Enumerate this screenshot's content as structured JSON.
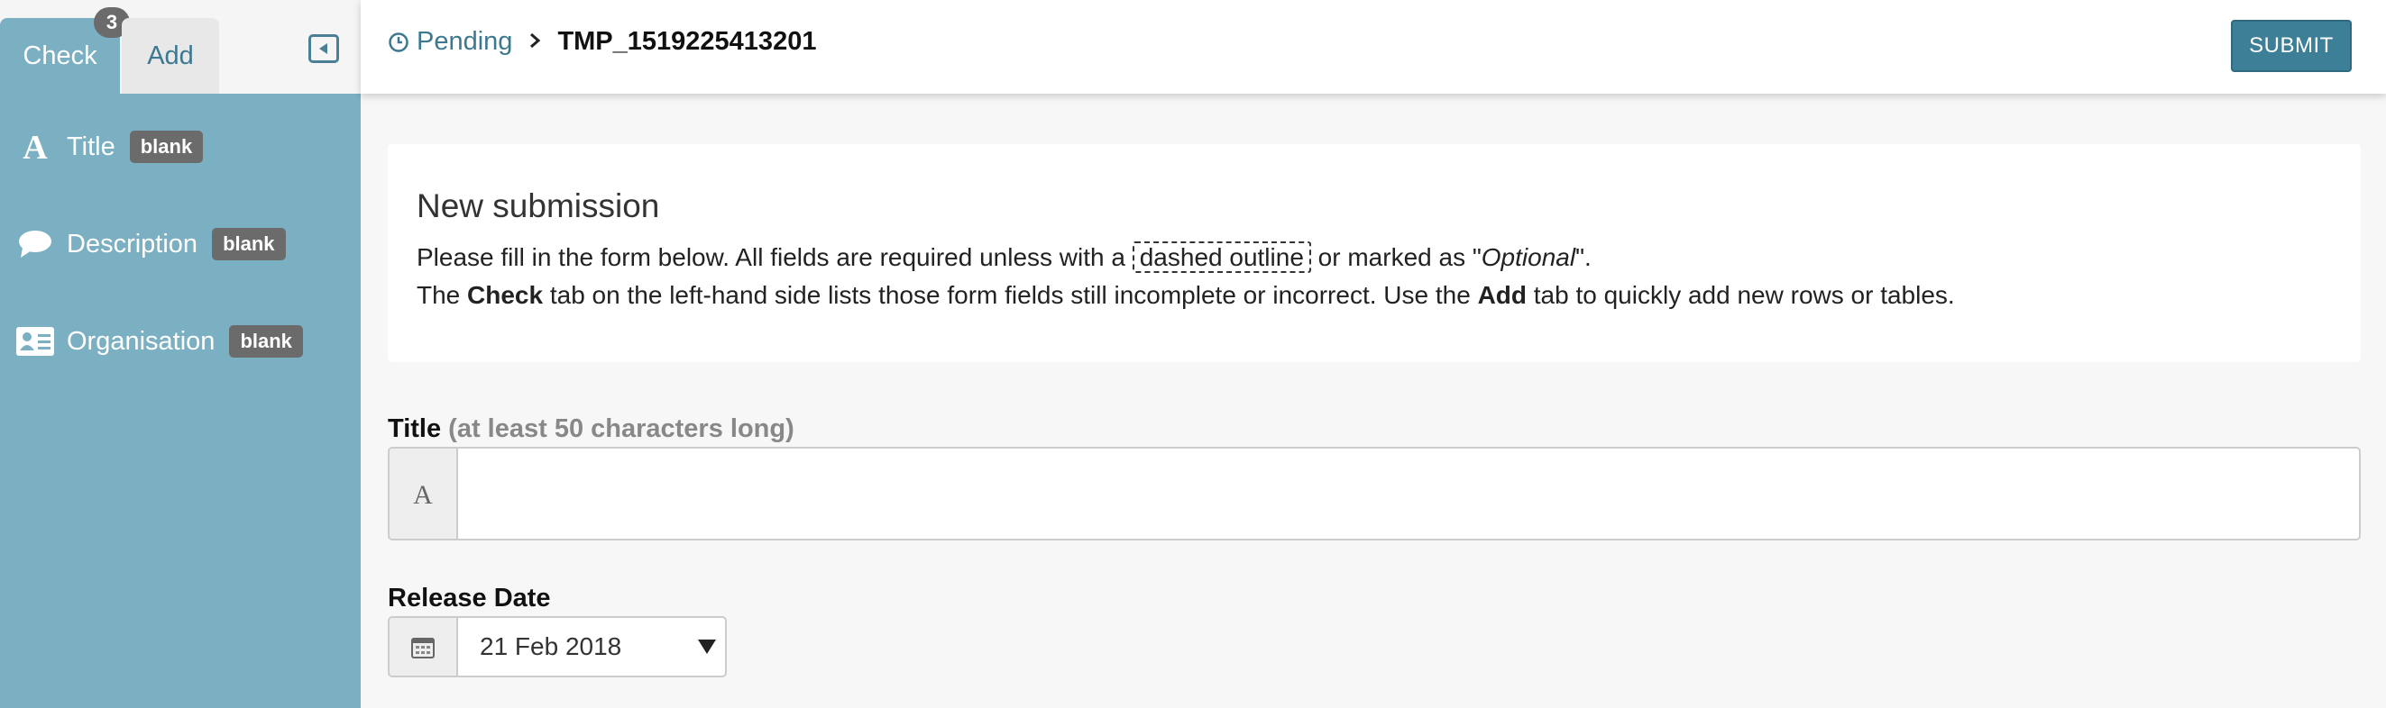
{
  "sidebar": {
    "tabs": [
      {
        "label": "Check"
      },
      {
        "label": "Add"
      }
    ],
    "check_count": "3",
    "items": [
      {
        "label": "Title",
        "status": "blank",
        "icon": "font-a-icon"
      },
      {
        "label": "Description",
        "status": "blank",
        "icon": "speech-bubble-icon"
      },
      {
        "label": "Organisation",
        "status": "blank",
        "icon": "id-card-icon"
      }
    ]
  },
  "header": {
    "breadcrumb_status": "Pending",
    "breadcrumb_id": "TMP_1519225413201",
    "submit_label": "SUBMIT"
  },
  "intro": {
    "title": "New submission",
    "line1_a": "Please fill in the form below. All fields are required unless with a ",
    "line1_dashed": "dashed outline",
    "line1_b": " or marked as \"",
    "line1_optional": "Optional",
    "line1_c": "\".",
    "line2_a": "The ",
    "line2_check": "Check",
    "line2_b": " tab on the left-hand side lists those form fields still incomplete or incorrect. Use the ",
    "line2_add": "Add",
    "line2_c": " tab to quickly add new rows or tables."
  },
  "form": {
    "title_label": "Title",
    "title_hint": "(at least 50 characters long)",
    "title_value": "",
    "release_label": "Release Date",
    "release_value": "21 Feb 2018"
  },
  "colors": {
    "sidebar_bg": "#7bafc2",
    "accent": "#3d7f96",
    "badge": "#6b6b6b"
  }
}
